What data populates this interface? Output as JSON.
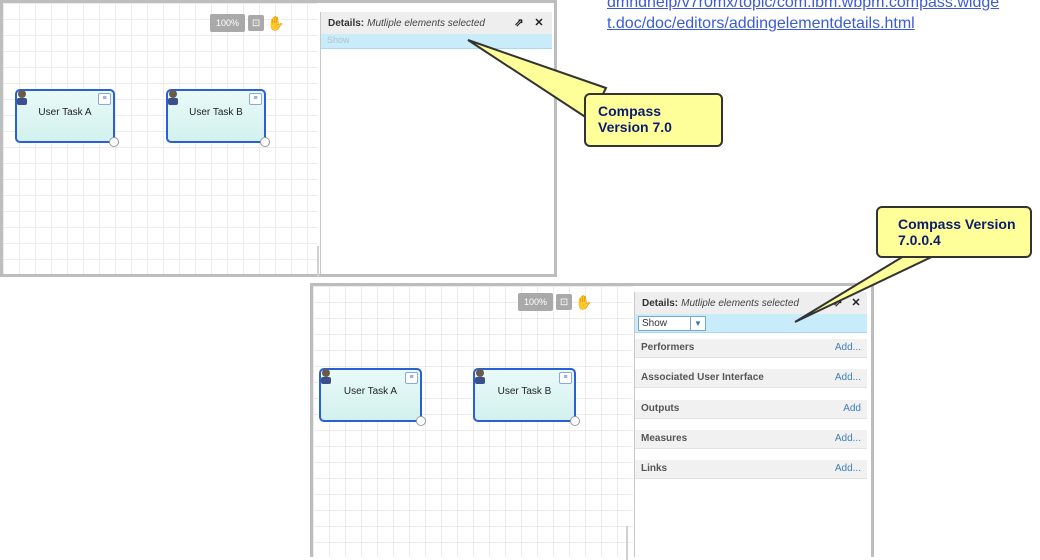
{
  "doc_link": {
    "text": "dmndhelp/v7r0mx/topic/com.ibm.wbpm.compass.widget.doc/doc/editors/addingelementdetails.html"
  },
  "callouts": {
    "v70": "Compass Version 7.0",
    "v7004": "Compass Version 7.0.0.4"
  },
  "editor_v70": {
    "zoom": "100%",
    "tasks": [
      "User Task A",
      "User Task B"
    ],
    "details": {
      "title": "Details:",
      "subtitle": "Mutliple elements selected",
      "show_label": "Show"
    }
  },
  "editor_v7004": {
    "zoom": "100%",
    "tasks": [
      "User Task A",
      "User Task B"
    ],
    "details": {
      "title": "Details:",
      "subtitle": "Mutliple elements selected",
      "show_select": "Show",
      "sections": [
        {
          "name": "Performers",
          "action": "Add..."
        },
        {
          "name": "Associated User Interface",
          "action": "Add..."
        },
        {
          "name": "Outputs",
          "action": "Add"
        },
        {
          "name": "Measures",
          "action": "Add..."
        },
        {
          "name": "Links",
          "action": "Add..."
        }
      ]
    }
  },
  "icons": {
    "fit": "fit-to-screen-icon",
    "hand": "pan-hand-icon",
    "restore": "restore-icon",
    "close": "close-icon",
    "user": "user-task-icon",
    "menu": "list-menu-icon"
  },
  "colors": {
    "task_border": "#2a5fd6",
    "task_fill": "#d2f1ee",
    "show_bar": "#c9ecfb",
    "callout_fill": "#ffff99",
    "callout_text": "#0b1b6e",
    "link": "#3c5bd8"
  }
}
